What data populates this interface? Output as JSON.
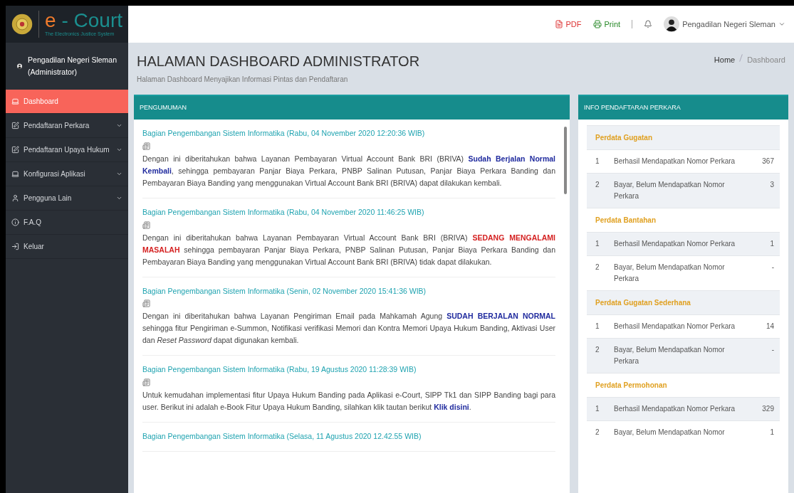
{
  "logo": {
    "title_first": "e",
    "title_rest": " - Court",
    "tagline": "The Electronics Justice System"
  },
  "topbar": {
    "pdf": "PDF",
    "print": "Print",
    "user": "Pengadilan Negeri Sleman"
  },
  "sidebar": {
    "user_name": "Pengadilan Negeri Sleman",
    "user_role": "(Administrator)",
    "items": [
      {
        "label": "Dashboard",
        "selected": true,
        "has_submenu": false
      },
      {
        "label": "Pendaftaran Perkara",
        "selected": false,
        "has_submenu": true
      },
      {
        "label": "Pendaftaran Upaya Hukum",
        "selected": false,
        "has_submenu": true
      },
      {
        "label": "Konfigurasi Aplikasi",
        "selected": false,
        "has_submenu": true
      },
      {
        "label": "Pengguna Lain",
        "selected": false,
        "has_submenu": true
      },
      {
        "label": "F.A.Q",
        "selected": false,
        "has_submenu": false
      },
      {
        "label": "Keluar",
        "selected": false,
        "has_submenu": false
      }
    ]
  },
  "page": {
    "title": "HALAMAN DASHBOARD ADMINISTRATOR",
    "subtitle": "Halaman Dashboard Menyajikan Informasi Pintas dan Pendaftaran",
    "breadcrumb": [
      "Home",
      "Dashboard"
    ]
  },
  "announcements": {
    "title": "PENGUMUMAN",
    "items": [
      {
        "heading": "Bagian Pengembangan Sistem Informatika (Rabu, 04 November 2020 12:20:36 WIB)",
        "body": [
          {
            "kind": "plain",
            "text": "Dengan ini diberitahukan bahwa Layanan Pembayaran Virtual Account Bank BRI (BRIVA) "
          },
          {
            "kind": "blue",
            "text": "Sudah Berjalan Normal Kembali"
          },
          {
            "kind": "plain",
            "text": ", sehingga pembayaran Panjar Biaya Perkara, PNBP Salinan Putusan, Panjar Biaya Perkara Banding dan Pembayaran Biaya Banding yang menggunakan Virtual Account Bank BRI (BRIVA) dapat dilakukan kembali."
          }
        ]
      },
      {
        "heading": "Bagian Pengembangan Sistem Informatika (Rabu, 04 November 2020 11:46:25 WIB)",
        "body": [
          {
            "kind": "plain",
            "text": "Dengan ini diberitahukan bahwa Layanan Pembayaran Virtual Account Bank BRI (BRIVA) "
          },
          {
            "kind": "red",
            "text": "SEDANG MENGALAMI MASALAH"
          },
          {
            "kind": "plain",
            "text": " sehingga pembayaran Panjar Biaya Perkara, PNBP Salinan Putusan, Panjar Biaya Perkara Banding dan Pembayaran Biaya Banding yang menggunakan Virtual Account Bank BRI (BRIVA) tidak dapat dilakukan."
          }
        ]
      },
      {
        "heading": "Bagian Pengembangan Sistem Informatika (Senin, 02 November 2020 15:41:36 WIB)",
        "body": [
          {
            "kind": "plain",
            "text": "Dengan ini diberitahukan bahwa Layanan Pengiriman Email pada Mahkamah Agung "
          },
          {
            "kind": "blue",
            "text": "SUDAH BERJALAN NORMAL"
          },
          {
            "kind": "plain",
            "text": " sehingga fitur Pengiriman e-Summon, Notifikasi verifikasi Memori dan Kontra Memori Upaya Hukum Banding, Aktivasi User dan "
          },
          {
            "kind": "italic",
            "text": "Reset Password"
          },
          {
            "kind": "plain",
            "text": " dapat digunakan kembali."
          }
        ]
      },
      {
        "heading": "Bagian Pengembangan Sistem Informatika (Rabu, 19 Agustus 2020 11:28:39 WIB)",
        "body": [
          {
            "kind": "plain",
            "text": "Untuk kemudahan implementasi fitur Upaya Hukum Banding pada Aplikasi e-Court, SIPP Tk1 dan SIPP Banding bagi para user. Berikut ini adalah e-Book Fitur Upaya Hukum Banding, silahkan klik tautan berikut "
          },
          {
            "kind": "link",
            "text": "Klik disini"
          },
          {
            "kind": "plain",
            "text": "."
          }
        ]
      },
      {
        "heading": "Bagian Pengembangan Sistem Informatika (Selasa, 11 Agustus 2020 12.42.55 WIB)"
      }
    ]
  },
  "info": {
    "title": "INFO PENDAFTARAN PERKARA",
    "sections": [
      {
        "name": "Perdata Gugatan",
        "rows": [
          {
            "no": "1",
            "label": "Berhasil Mendapatkan Nomor Perkara",
            "value": "367"
          },
          {
            "no": "2",
            "label": "Bayar, Belum Mendapatkan Nomor Perkara",
            "value": "3"
          }
        ]
      },
      {
        "name": "Perdata Bantahan",
        "rows": [
          {
            "no": "1",
            "label": "Berhasil Mendapatkan Nomor Perkara",
            "value": "1"
          },
          {
            "no": "2",
            "label": "Bayar, Belum Mendapatkan Nomor Perkara",
            "value": "-"
          }
        ]
      },
      {
        "name": "Perdata Gugatan Sederhana",
        "rows": [
          {
            "no": "1",
            "label": "Berhasil Mendapatkan Nomor Perkara",
            "value": "14"
          },
          {
            "no": "2",
            "label": "Bayar, Belum Mendapatkan Nomor Perkara",
            "value": "-"
          }
        ]
      },
      {
        "name": "Perdata Permohonan",
        "rows": [
          {
            "no": "1",
            "label": "Berhasil Mendapatkan Nomor Perkara",
            "value": "329"
          },
          {
            "no": "2",
            "label": "Bayar, Belum Mendapatkan Nomor",
            "value": "1"
          }
        ]
      }
    ]
  }
}
